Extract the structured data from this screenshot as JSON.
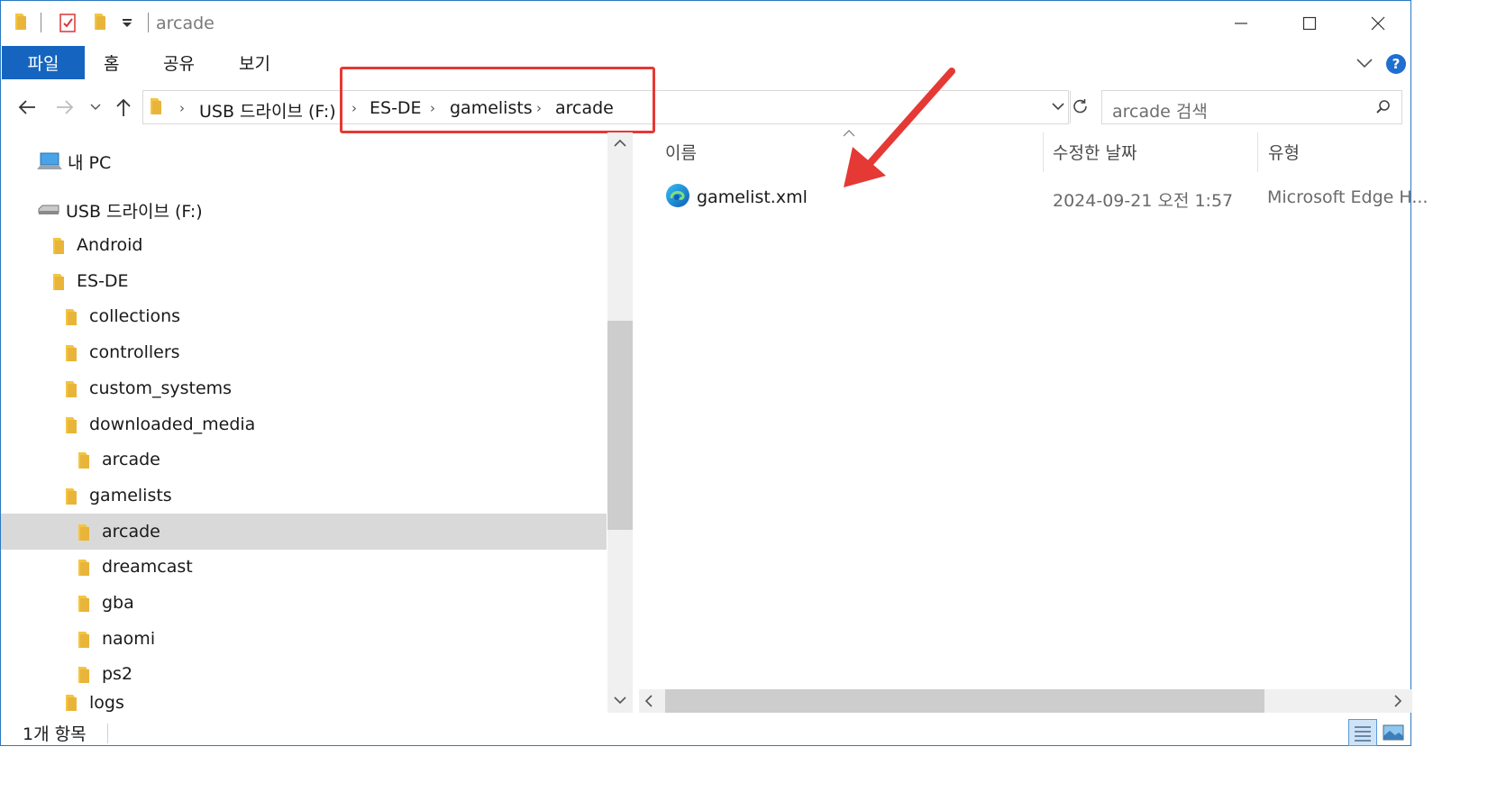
{
  "window": {
    "title": "arcade",
    "ribbon_tabs": [
      "파일",
      "홈",
      "공유",
      "보기"
    ]
  },
  "address": {
    "crumbs": [
      "USB 드라이브 (F:)",
      "ES-DE",
      "gamelists",
      "arcade"
    ],
    "search_placeholder": "arcade 검색"
  },
  "nav": {
    "this_pc": "내 PC",
    "drive": "USB 드라이브 (F:)",
    "items": [
      {
        "label": "Android",
        "level": 1
      },
      {
        "label": "ES-DE",
        "level": 1
      },
      {
        "label": "collections",
        "level": 2
      },
      {
        "label": "controllers",
        "level": 2
      },
      {
        "label": "custom_systems",
        "level": 2
      },
      {
        "label": "downloaded_media",
        "level": 2
      },
      {
        "label": "arcade",
        "level": 3
      },
      {
        "label": "gamelists",
        "level": 2
      },
      {
        "label": "arcade",
        "level": 3,
        "selected": true
      },
      {
        "label": "dreamcast",
        "level": 3
      },
      {
        "label": "gba",
        "level": 3
      },
      {
        "label": "naomi",
        "level": 3
      },
      {
        "label": "ps2",
        "level": 3
      },
      {
        "label": "logs",
        "level": 2
      }
    ]
  },
  "list": {
    "columns": {
      "name": "이름",
      "date": "수정한 날짜",
      "type": "유형"
    },
    "rows": [
      {
        "name": "gamelist.xml",
        "date": "2024-09-21 오전 1:57",
        "type": "Microsoft Edge H...",
        "icon": "edge-icon"
      }
    ]
  },
  "status": {
    "count": "1개 항목"
  },
  "colors": {
    "accent": "#1565c0",
    "highlight": "#e53935",
    "selection": "#d9d9d9",
    "folder": "#f4c542"
  }
}
